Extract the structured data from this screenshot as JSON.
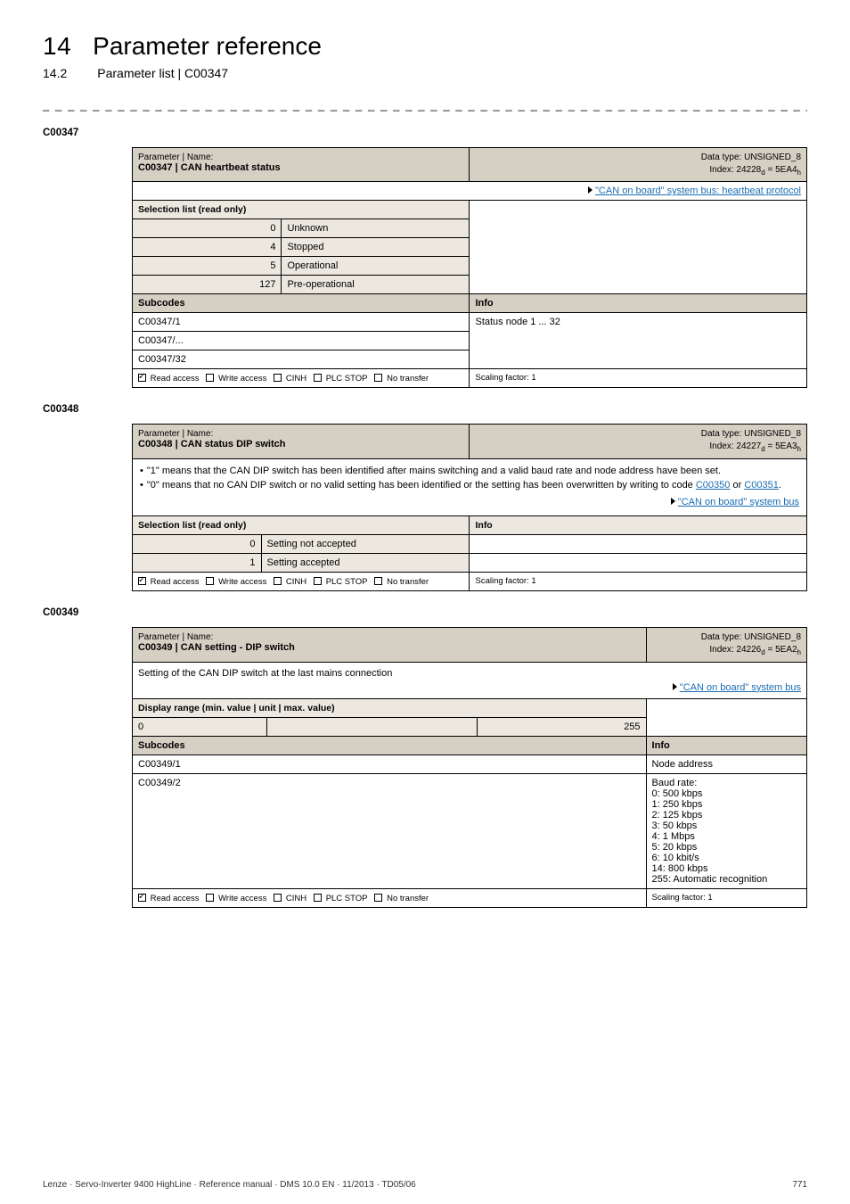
{
  "header": {
    "chapter_num": "14",
    "chapter_title": "Parameter reference",
    "sub_num": "14.2",
    "sub_title": "Parameter list | C00347"
  },
  "p347": {
    "heading": "C00347",
    "name_label": "Parameter | Name:",
    "name": "C00347 | CAN heartbeat status",
    "dtype": "Data type: UNSIGNED_8",
    "index": "Index: 24228",
    "index_d": "d",
    "index_eq": " = 5EA4",
    "index_h": "h",
    "link1": "\"CAN on board\" system bus: heartbeat protocol",
    "sel_label": "Selection list (read only)",
    "rows": [
      {
        "n": "0",
        "v": "Unknown"
      },
      {
        "n": "4",
        "v": "Stopped"
      },
      {
        "n": "5",
        "v": "Operational"
      },
      {
        "n": "127",
        "v": "Pre-operational"
      }
    ],
    "subcodes_label": "Subcodes",
    "info_label": "Info",
    "sc": [
      "C00347/1",
      "C00347/...",
      "C00347/32"
    ],
    "sc_info": "Status node 1 ... 32",
    "footer_read": "Read access",
    "footer_write": "Write access",
    "footer_cinh": "CINH",
    "footer_plc": "PLC STOP",
    "footer_not": "No transfer",
    "scaling": "Scaling factor: 1"
  },
  "p348": {
    "heading": "C00348",
    "name_label": "Parameter | Name:",
    "name": "C00348 | CAN status DIP switch",
    "dtype": "Data type: UNSIGNED_8",
    "index": "Index: 24227",
    "index_d": "d",
    "index_eq": " = 5EA3",
    "index_h": "h",
    "b1a": "\"1\" means that the CAN DIP switch has been identified after mains switching and a valid baud rate and node address have been set.",
    "b2a": "\"0\" means that no CAN DIP switch or no valid setting has been identified or the setting has been overwritten by writing to code ",
    "b2_link1": "C00350",
    "b2_or": " or ",
    "b2_link2": "C00351",
    "b2_end": ".",
    "link1": "\"CAN on board\" system bus",
    "sel_label": "Selection list (read only)",
    "info_label": "Info",
    "rows": [
      {
        "n": "0",
        "v": "Setting not accepted"
      },
      {
        "n": "1",
        "v": "Setting accepted"
      }
    ],
    "footer_read": "Read access",
    "footer_write": "Write access",
    "footer_cinh": "CINH",
    "footer_plc": "PLC STOP",
    "footer_not": "No transfer",
    "scaling": "Scaling factor: 1"
  },
  "p349": {
    "heading": "C00349",
    "name_label": "Parameter | Name:",
    "name": "C00349 | CAN setting - DIP switch",
    "dtype": "Data type: UNSIGNED_8",
    "index": "Index: 24226",
    "index_d": "d",
    "index_eq": " = 5EA2",
    "index_h": "h",
    "desc": "Setting of the CAN DIP switch at the last mains connection",
    "link1": "\"CAN on board\" system bus",
    "range_label": "Display range (min. value | unit | max. value)",
    "range_min": "0",
    "range_max": "255",
    "subcodes_label": "Subcodes",
    "info_label": "Info",
    "r1_sc": "C00349/1",
    "r1_info": "Node address",
    "r2_sc": "C00349/2",
    "r2_info": "Baud rate:\n0: 500 kbps\n1: 250 kbps\n2: 125 kbps\n3: 50 kbps\n4: 1 Mbps\n5: 20 kbps\n6: 10 kbit/s\n14: 800 kbps\n255: Automatic recognition",
    "footer_read": "Read access",
    "footer_write": "Write access",
    "footer_cinh": "CINH",
    "footer_plc": "PLC STOP",
    "footer_not": "No transfer",
    "scaling": "Scaling factor: 1"
  },
  "footer": {
    "left": "Lenze · Servo-Inverter 9400 HighLine · Reference manual · DMS 10.0 EN · 11/2013 · TD05/06",
    "page": "771"
  },
  "dashes": "_ _ _ _ _ _ _ _ _ _ _ _ _ _ _ _ _ _ _ _ _ _ _ _ _ _ _ _ _ _ _ _ _ _ _ _ _ _ _ _ _ _ _ _ _ _ _ _ _ _ _ _ _ _ _ _ _ _ _ _ _ _ _ _"
}
